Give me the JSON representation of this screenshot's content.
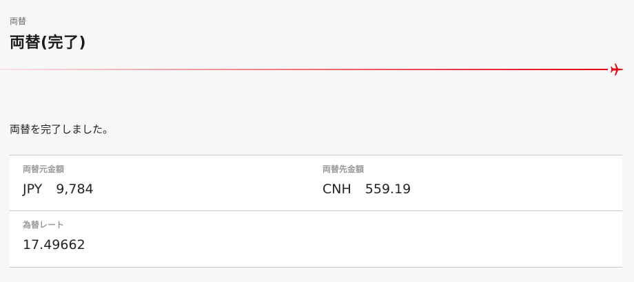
{
  "header": {
    "breadcrumb": "両替",
    "title": "両替(完了)"
  },
  "message": "両替を完了しました。",
  "result": {
    "source": {
      "label": "両替元金額",
      "currency": "JPY",
      "amount": "9,784"
    },
    "destination": {
      "label": "両替先金額",
      "currency": "CNH",
      "amount": "559.19"
    },
    "rate": {
      "label": "為替レート",
      "value": "17.49662"
    }
  },
  "colors": {
    "accent": "#e60012",
    "background": "#f7f7f7",
    "card": "#ffffff",
    "label": "#9a9a9a"
  },
  "icons": {
    "progress_end": "airplane-icon"
  }
}
